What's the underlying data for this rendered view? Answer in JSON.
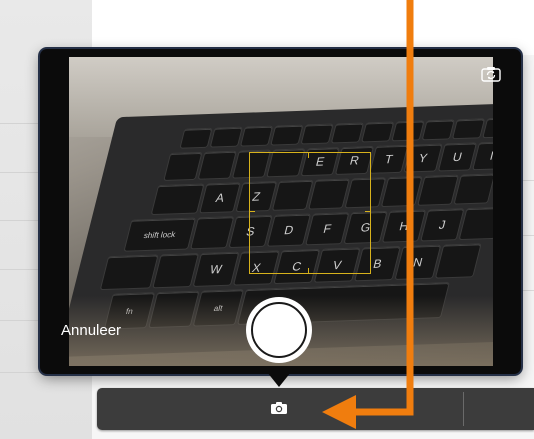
{
  "camera": {
    "cancel_label": "Annuleer",
    "icons": {
      "switch_camera": "camera-switch-icon",
      "shutter": "shutter-button",
      "toolbar_camera": "camera-icon"
    },
    "focus_color": "#d7b21c"
  },
  "keyboard": {
    "keys": [
      "E",
      "R",
      "T",
      "Y",
      "U",
      "I",
      "A",
      "Z",
      "S",
      "D",
      "F",
      "G",
      "H",
      "J",
      "W",
      "X",
      "C",
      "V",
      "B",
      "N",
      "fn",
      "alt",
      "shift lock"
    ]
  },
  "annotation": {
    "color": "#f07d0e"
  },
  "toolbar": {
    "background": "#3c3c3c"
  }
}
